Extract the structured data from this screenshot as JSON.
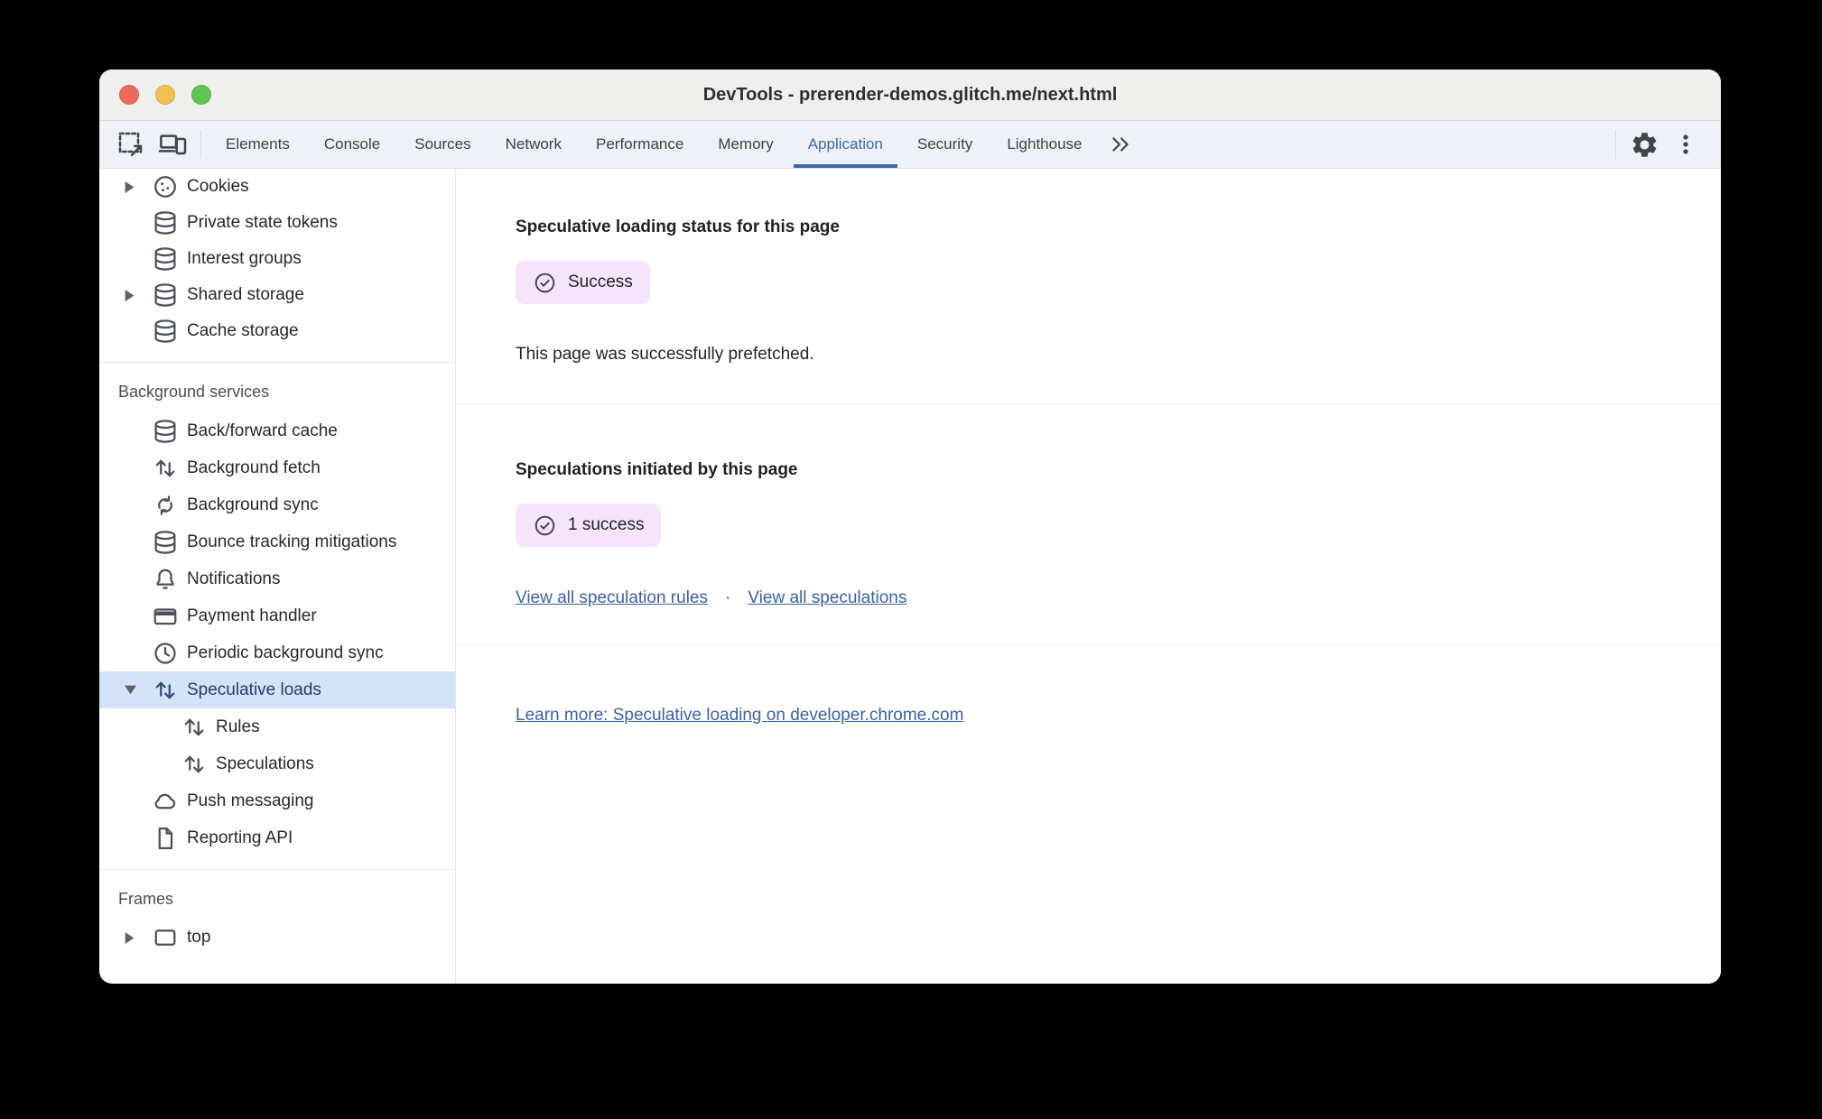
{
  "window": {
    "title": "DevTools - prerender-demos.glitch.me/next.html"
  },
  "tabbar": {
    "tabs": [
      "Elements",
      "Console",
      "Sources",
      "Network",
      "Performance",
      "Memory",
      "Application",
      "Security",
      "Lighthouse"
    ],
    "active_tab": "Application"
  },
  "sidebar": {
    "storage": [
      "Cookies",
      "Private state tokens",
      "Interest groups",
      "Shared storage",
      "Cache storage"
    ],
    "background_header": "Background services",
    "background": [
      "Back/forward cache",
      "Background fetch",
      "Background sync",
      "Bounce tracking mitigations",
      "Notifications",
      "Payment handler",
      "Periodic background sync",
      "Speculative loads",
      "Rules",
      "Speculations",
      "Push messaging",
      "Reporting API"
    ],
    "selected_item": "Speculative loads",
    "frames_header": "Frames",
    "frames": [
      "top"
    ]
  },
  "main": {
    "status_heading": "Speculative loading status for this page",
    "status_badge": "Success",
    "status_body": "This page was successfully prefetched.",
    "spec_heading": "Speculations initiated by this page",
    "spec_badge": "1 success",
    "link_rules": "View all speculation rules",
    "link_separator": "·",
    "link_specs": "View all speculations",
    "learn_more": "Learn more: Speculative loading on developer.chrome.com"
  },
  "colors": {
    "accent_active_tab": "#3e68ae",
    "badge_background": "#f6e3fc",
    "selected_row_background": "#d5e3f8",
    "selected_row_text": "#1d3e6f",
    "link": "#3c62a9",
    "traffic_red": "#ed6a5e",
    "traffic_yellow": "#f5bf4f",
    "traffic_green": "#61c554"
  }
}
